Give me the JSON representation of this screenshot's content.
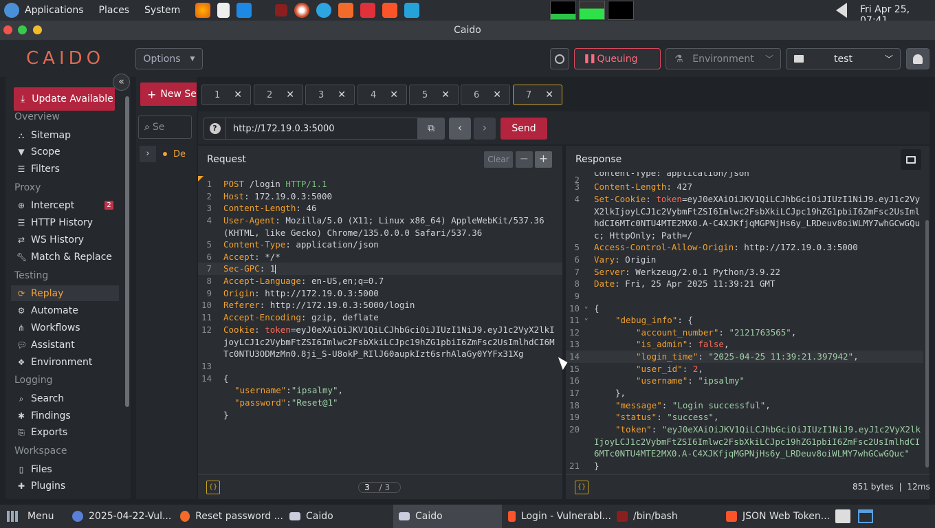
{
  "os_panel": {
    "menus": [
      "Applications",
      "Places",
      "System"
    ],
    "clock": "Fri Apr 25, 07:41"
  },
  "window": {
    "title": "Caido"
  },
  "header": {
    "logo": "CAIDO",
    "options_label": "Options",
    "queuing_label": "Queuing",
    "environment_label": "Environment",
    "project_label": "test"
  },
  "sidebar": {
    "update_label": "Update Available",
    "sections": {
      "overview": "Overview",
      "proxy": "Proxy",
      "testing": "Testing",
      "logging": "Logging",
      "workspace": "Workspace"
    },
    "items": {
      "sitemap": "Sitemap",
      "scope": "Scope",
      "filters": "Filters",
      "intercept": "Intercept",
      "intercept_badge": "2",
      "http_history": "HTTP History",
      "ws_history": "WS History",
      "match_replace": "Match & Replace",
      "replay": "Replay",
      "automate": "Automate",
      "workflows": "Workflows",
      "assistant": "Assistant",
      "environment": "Environment",
      "search": "Search",
      "findings": "Findings",
      "exports": "Exports",
      "files": "Files",
      "plugins": "Plugins"
    }
  },
  "collections": {
    "new_label": "New Se",
    "search_placeholder": "Se",
    "item_label": "De"
  },
  "tabs": [
    "1",
    "2",
    "3",
    "4",
    "5",
    "6",
    "7"
  ],
  "url_bar": {
    "value": "http://172.19.0.3:5000",
    "send_label": "Send"
  },
  "request": {
    "title": "Request",
    "clear_label": "Clear",
    "page_current": "3",
    "page_total": "/ 3",
    "lines": [
      {
        "n": "1",
        "method": "POST",
        "path": " /login ",
        "proto": "HTTP/1.1"
      },
      {
        "n": "2",
        "k": "Host",
        "v": " 172.19.0.3:5000"
      },
      {
        "n": "3",
        "k": "Content-Length",
        "v": " 46"
      },
      {
        "n": "4",
        "k": "User-Agent",
        "v": " Mozilla/5.0 (X11; Linux x86_64) AppleWebKit/537.36",
        "v2": "(KHTML, like Gecko) Chrome/135.0.0.0 Safari/537.36"
      },
      {
        "n": "5",
        "k": "Content-Type",
        "v": " application/json"
      },
      {
        "n": "6",
        "k": "Accept",
        "v": " */*"
      },
      {
        "n": "7",
        "k": "Sec-GPC",
        "v": " 1"
      },
      {
        "n": "8",
        "k": "Accept-Language",
        "v": " en-US,en;q=0.7"
      },
      {
        "n": "9",
        "k": "Origin",
        "v": " http://172.19.0.3:5000"
      },
      {
        "n": "10",
        "k": "Referer",
        "v": " http://172.19.0.3:5000/login"
      },
      {
        "n": "11",
        "k": "Accept-Encoding",
        "v": " gzip, deflate"
      },
      {
        "n": "12",
        "k": "Cookie",
        "ck": "token",
        "v": "=eyJ0eXAiOiJKV1QiLCJhbGciOiJIUzI1NiJ9.eyJ1c2VyX2lkI",
        "v2": "joyLCJ1c2VybmFtZSI6Imlwc2FsbXkiLCJpc19hZG1pbiI6ZmFsc2UsImlhdCI6M",
        "v3": "Tc0NTU3ODMzMn0.8ji_S-U8okP_RIlJ60aupkIzt6srhAlaGy0YYFx31Xg"
      },
      {
        "n": "13"
      },
      {
        "n": "14",
        "brace": "{"
      }
    ],
    "body": {
      "k1": "\"username\"",
      "v1": "\"ipsalmy\"",
      "k2": "\"password\"",
      "v2": "\"Reset@1\"",
      "close": "}"
    }
  },
  "response": {
    "title": "Response",
    "stats": "851 bytes",
    "time": "12ms",
    "partial_top": "Content-Type: application/json",
    "lines": [
      {
        "n": "2"
      },
      {
        "n": "3",
        "k": "Content-Length",
        "v": " 427"
      },
      {
        "n": "4",
        "k": "Set-Cookie",
        "ck": "token",
        "v": "=eyJ0eXAiOiJKV1QiLCJhbGciOiJIUzI1NiJ9.eyJ1c2Vy",
        "v2": "X2lkIjoyLCJ1c2VybmFtZSI6Imlwc2FsbXkiLCJpc19hZG1pbiI6ZmFsc2UsIml",
        "v3": "hdCI6MTc0NTU4MTE2MX0.A-C4XJKfjqMGPNjHs6y_LRDeuv8oiWLMY7whGCwGQu",
        "v4": "c; HttpOnly; Path=/"
      },
      {
        "n": "5",
        "k": "Access-Control-Allow-Origin",
        "v": " http://172.19.0.3:5000"
      },
      {
        "n": "6",
        "k": "Vary",
        "v": " Origin"
      },
      {
        "n": "7",
        "k": "Server",
        "v": " Werkzeug/2.0.1 Python/3.9.22"
      },
      {
        "n": "8",
        "k": "Date",
        "v": " Fri, 25 Apr 2025 11:39:21 GMT"
      },
      {
        "n": "9"
      },
      {
        "n": "10"
      },
      {
        "n": "11"
      },
      {
        "n": "12"
      },
      {
        "n": "13"
      },
      {
        "n": "14"
      },
      {
        "n": "15"
      },
      {
        "n": "16"
      },
      {
        "n": "17"
      },
      {
        "n": "18"
      },
      {
        "n": "19"
      },
      {
        "n": "20"
      },
      {
        "n": "21"
      }
    ],
    "json": {
      "debug_info": "\"debug_info\"",
      "account_number_k": "\"account_number\"",
      "account_number_v": "\"2121763565\"",
      "is_admin_k": "\"is_admin\"",
      "is_admin_v": "false",
      "login_time_k": "\"login_time\"",
      "login_time_v": "\"2025-04-25 11:39:21.397942\"",
      "user_id_k": "\"user_id\"",
      "user_id_v": "2",
      "username_k": "\"username\"",
      "username_v": "\"ipsalmy\"",
      "message_k": "\"message\"",
      "message_v": "\"Login successful\"",
      "status_k": "\"status\"",
      "status_v": "\"success\"",
      "token_k": "\"token\"",
      "token_v1": "\"eyJ0eXAiOiJKV1QiLCJhbGciOiJIUzI1NiJ9.eyJ1c2VyX2lk",
      "token_v2": "IjoyLCJ1c2VybmFtZSI6Imlwc2FsbXkiLCJpc19hZG1pbiI6ZmFsc2UsImlhdCI",
      "token_v3": "6MTc0NTU4MTE2MX0.A-C4XJKfjqMGPNjHs6y_LRDeuv8oiWLMY7whGCwGQuc\""
    }
  },
  "taskbar": {
    "menu": "Menu",
    "items": [
      "2025-04-22-Vul...",
      "Reset password ...",
      "Caido",
      "Caido",
      "Login - Vulnerabl...",
      "/bin/bash",
      "JSON Web Token..."
    ]
  },
  "colors": {
    "accent": "#b3253f",
    "logo": "#e06a52",
    "active_tab": "#c9a227"
  }
}
